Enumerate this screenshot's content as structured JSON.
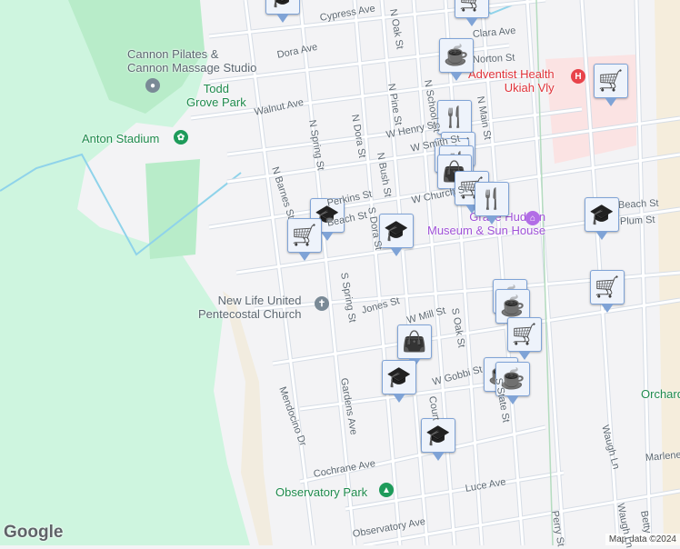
{
  "streets": [
    "Cypress Ave",
    "Dora Ave",
    "Walnut Ave",
    "N Oak St",
    "Clara Ave",
    "Norton St",
    "N Pine St",
    "N School St",
    "N Dora St",
    "N Spring St",
    "W Henry St",
    "W Smith St",
    "N Bush St",
    "N Barnes St",
    "Perkins St",
    "W Church St",
    "Beach St",
    "S Spring St",
    "Jones St",
    "W Mill St",
    "S Oak St",
    "W Gobbi St",
    "Court",
    "Gardens Ave",
    "Mendocino Dr",
    "Cochrane Ave",
    "Luce Ave",
    "Observatory Ave",
    "Perry St",
    "Waugh Ln",
    "Waugh Ln",
    "Marlene",
    "Betty",
    "Beach St",
    "Plum St",
    "N Main St",
    "S State St",
    "S Dora St"
  ],
  "pois": {
    "cannon": "Cannon Pilates & Cannon Massage Studio",
    "cannon_l1": "Cannon Pilates &",
    "cannon_l2": "Cannon Massage Studio",
    "todd_l1": "Todd",
    "todd_l2": "Grove Park",
    "anton": "Anton Stadium",
    "adventist_l1": "Adventist Health",
    "adventist_l2": "Ukiah Vly",
    "grace_l1": "Grace Hudson",
    "grace_l2": "Museum & Sun House",
    "church_l1": "New Life United",
    "church_l2": "Pentecostal Church",
    "observatory": "Observatory Park",
    "orchard": "Orchard Park"
  },
  "markers": [
    "cart",
    "school",
    "coffee",
    "cart",
    "restaurant",
    "cart",
    "coffee",
    "restaurant",
    "bag",
    "cart",
    "restaurant",
    "school",
    "cart",
    "school",
    "school",
    "cart",
    "coffee",
    "coffee",
    "cart",
    "bag",
    "school",
    "coffee",
    "coffee",
    "school"
  ],
  "attribution": "Map data ©2024",
  "logo": "Google",
  "colors": {
    "marker_border": "#7fa3d6",
    "marker_icon": "#0b3f66",
    "park": "#b8ecc9",
    "hills": "#cef5df",
    "hospital": "#fbe3e3"
  }
}
